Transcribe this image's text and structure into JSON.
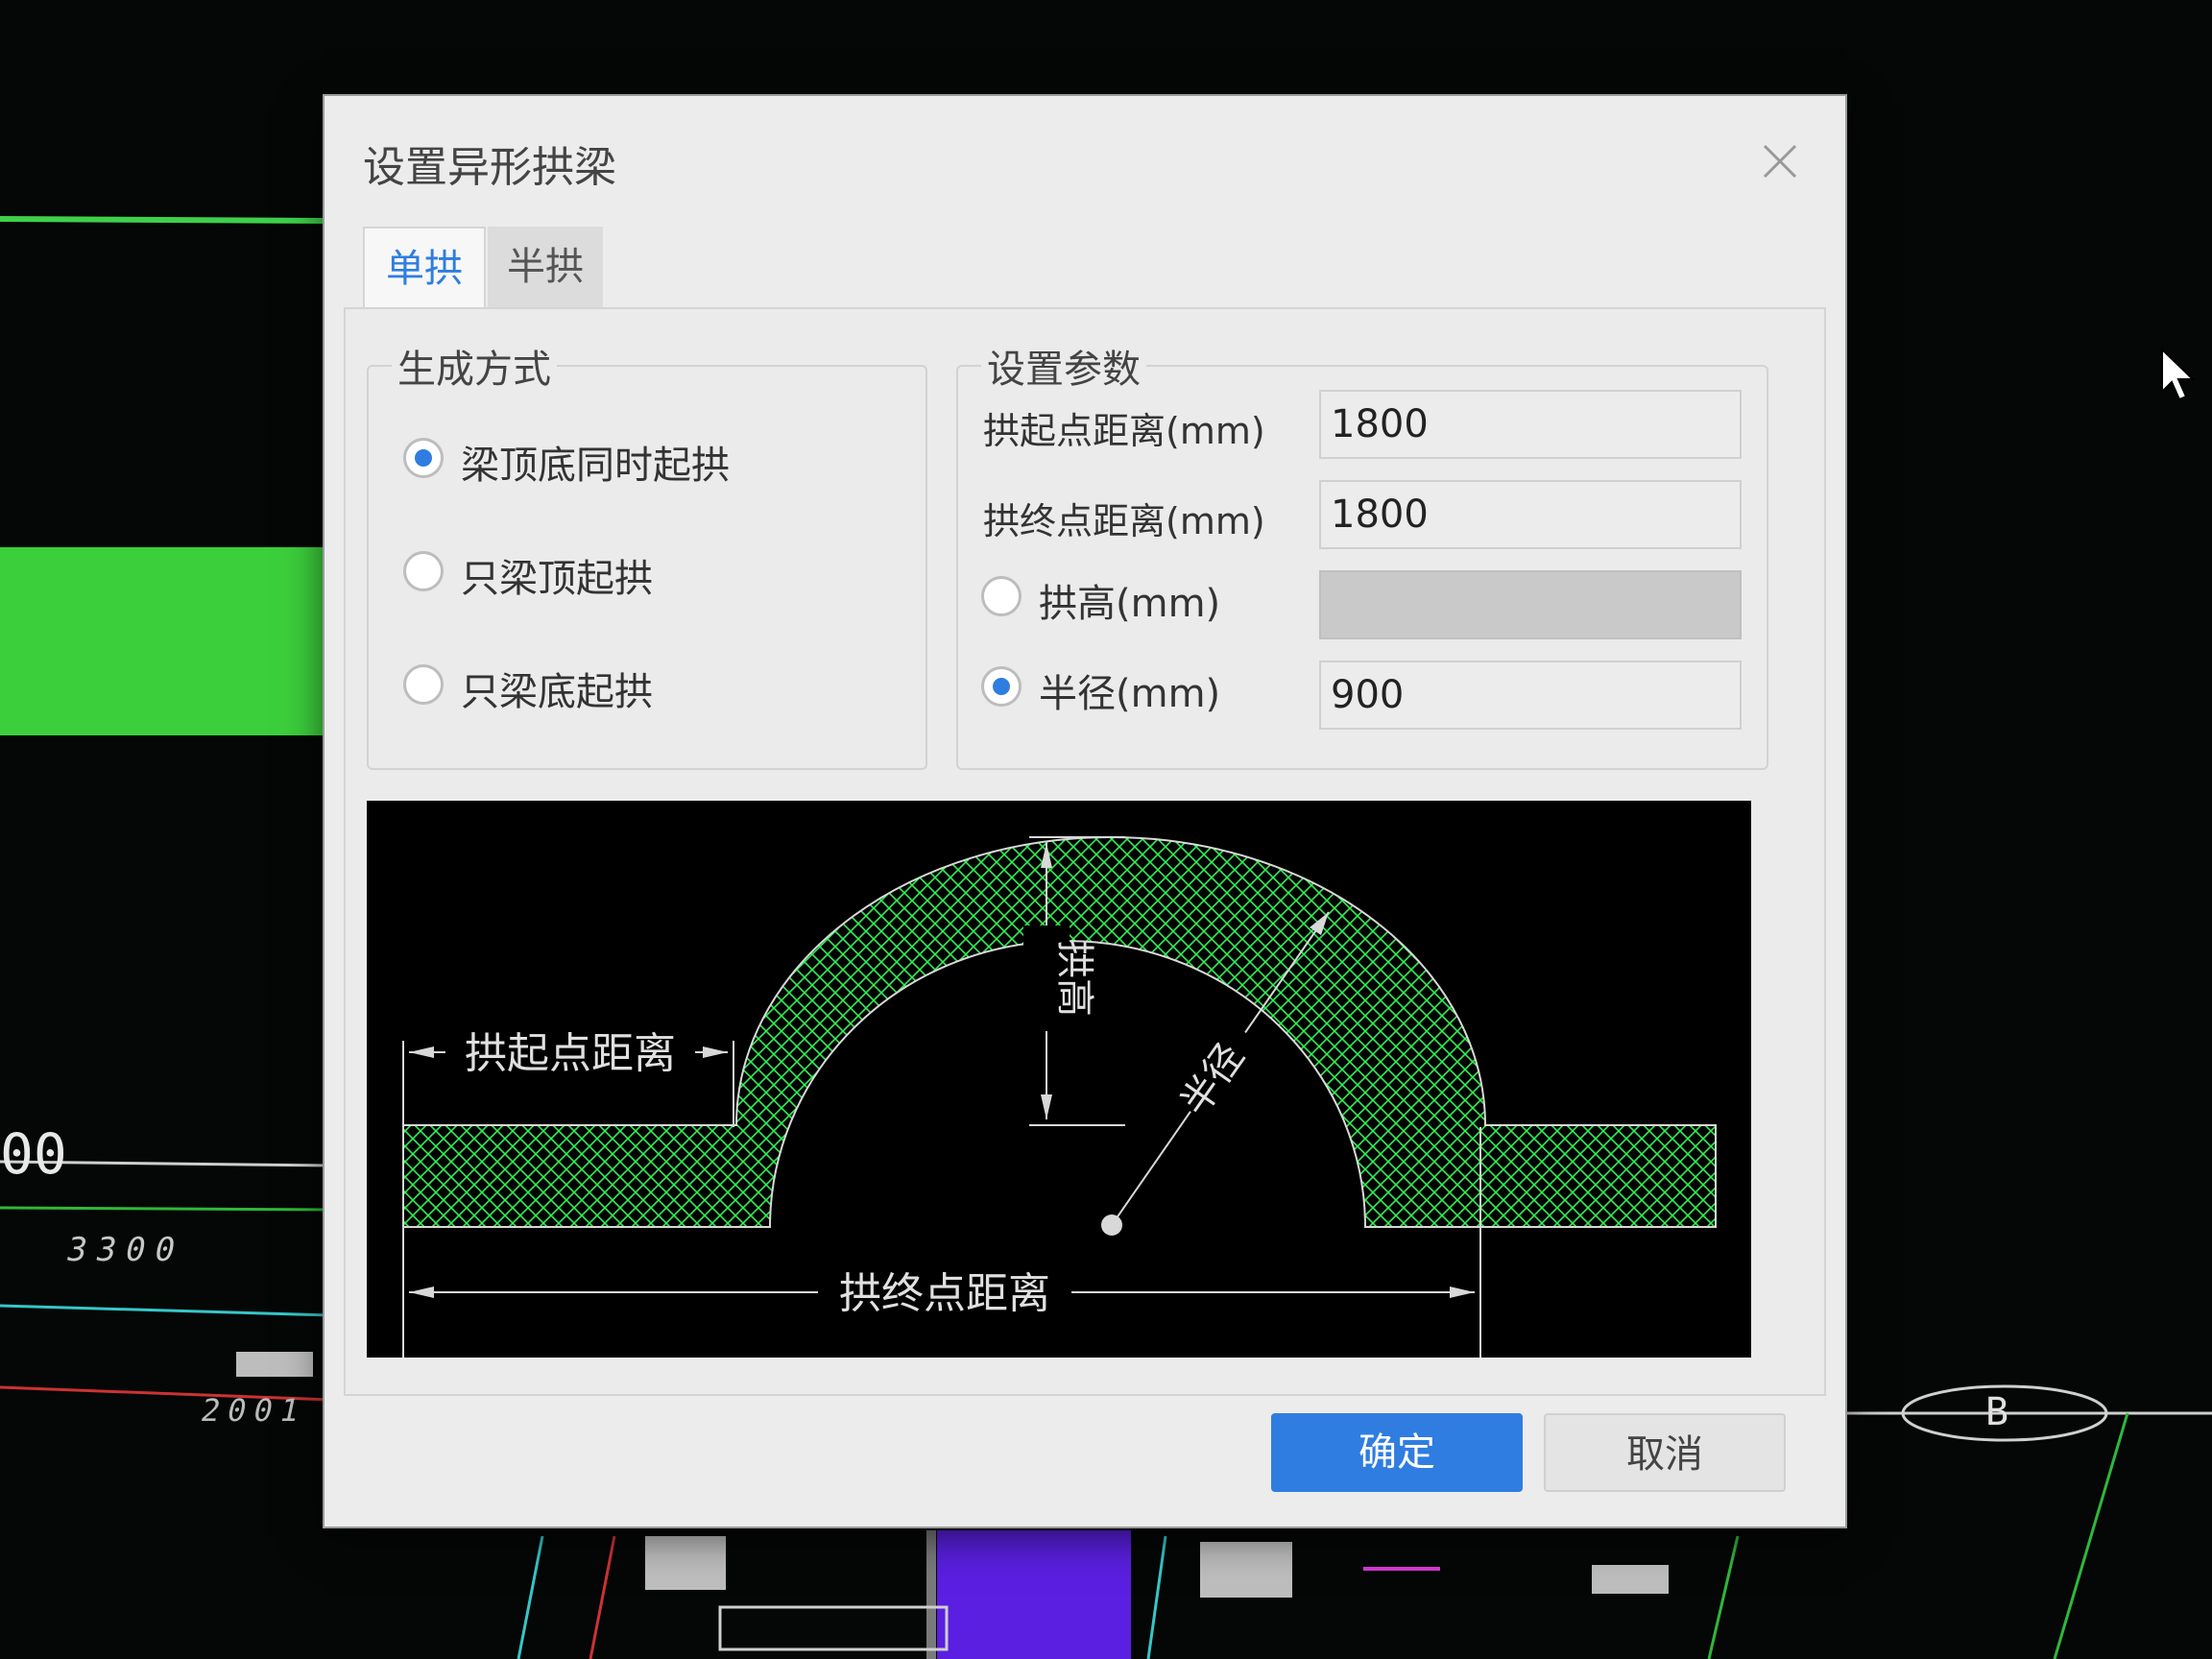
{
  "dialog": {
    "title": "设置异形拱梁",
    "tabs": [
      {
        "label": "单拱",
        "active": true
      },
      {
        "label": "半拱",
        "active": false
      }
    ],
    "method_group": {
      "title": "生成方式",
      "options": [
        {
          "label": "梁顶底同时起拱",
          "checked": true
        },
        {
          "label": "只梁顶起拱",
          "checked": false
        },
        {
          "label": "只梁底起拱",
          "checked": false
        }
      ]
    },
    "params_group": {
      "title": "设置参数",
      "start_distance": {
        "label": "拱起点距离(mm)",
        "value": "1800"
      },
      "end_distance": {
        "label": "拱终点距离(mm)",
        "value": "1800"
      },
      "arch_height": {
        "label": "拱高(mm)",
        "value": "",
        "selected": false
      },
      "radius": {
        "label": "半径(mm)",
        "value": "900",
        "selected": true
      }
    },
    "preview": {
      "start_distance_label": "拱起点距离",
      "end_distance_label": "拱终点距离",
      "height_label": "拱高",
      "radius_label": "半径"
    },
    "buttons": {
      "ok": "确定",
      "cancel": "取消"
    }
  },
  "cad_background": {
    "dim_left": "00",
    "dim_3300": "3300",
    "dim_2001": "2001",
    "axis_label": "B"
  },
  "colors": {
    "accent": "#2f7de0",
    "hatch": "#33ee55",
    "cad_green": "#3ccf3c",
    "cad_purple": "#5a1fe0"
  }
}
